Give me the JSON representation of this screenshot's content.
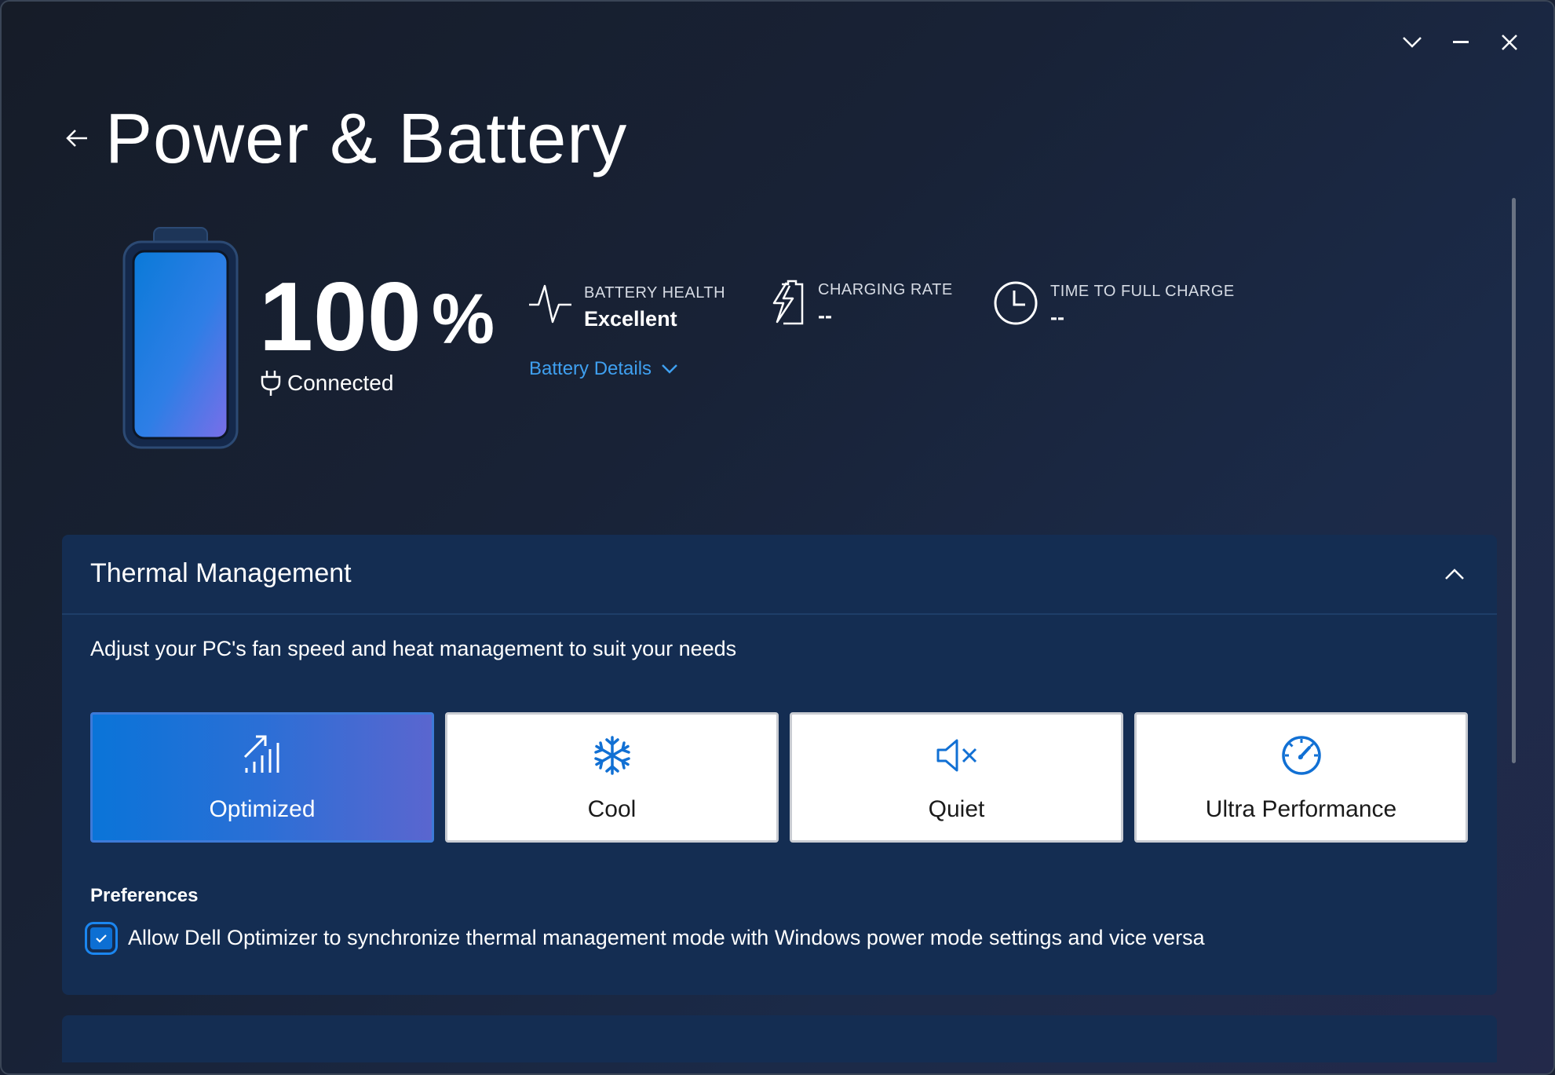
{
  "window": {
    "controls": {
      "dropdown_icon": "chevron-down-icon",
      "minimize_icon": "minimize-icon",
      "close_icon": "close-icon"
    }
  },
  "header": {
    "back_icon": "arrow-left-icon",
    "title": "Power & Battery"
  },
  "battery": {
    "percent": "100",
    "percent_sign": "%",
    "status": "Connected",
    "status_icon": "plug-icon",
    "fill_level": 1.0,
    "colors": {
      "fill_start": "#0a7ad8",
      "fill_end": "#7a6ee8"
    }
  },
  "stats": {
    "health": {
      "label": "BATTERY HEALTH",
      "value": "Excellent",
      "icon": "pulse-icon"
    },
    "charging_rate": {
      "label": "CHARGING RATE",
      "value": "--",
      "icon": "charging-battery-icon"
    },
    "time_to_full": {
      "label": "TIME TO FULL CHARGE",
      "value": "--",
      "icon": "clock-icon"
    },
    "details_link": "Battery Details"
  },
  "thermal": {
    "title": "Thermal Management",
    "description": "Adjust your PC's fan speed and heat management to suit your needs",
    "modes": [
      {
        "label": "Optimized",
        "icon": "signal-arrow-icon",
        "selected": true
      },
      {
        "label": "Cool",
        "icon": "snowflake-icon",
        "selected": false
      },
      {
        "label": "Quiet",
        "icon": "mute-icon",
        "selected": false
      },
      {
        "label": "Ultra Performance",
        "icon": "speedometer-icon",
        "selected": false
      }
    ],
    "preferences_title": "Preferences",
    "preference": {
      "label": "Allow Dell Optimizer to synchronize thermal management mode with Windows power mode settings and vice versa",
      "checked": true
    }
  },
  "colors": {
    "accent": "#0d6fd3",
    "link": "#3fa0f0",
    "card_bg": "#142d52"
  }
}
